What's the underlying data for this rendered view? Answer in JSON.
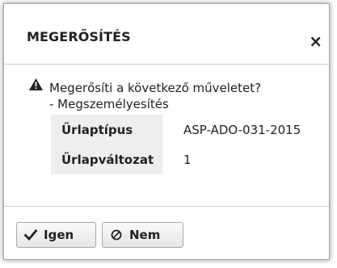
{
  "dialog": {
    "title": "MEGERŐSÍTÉS",
    "close_label": "×",
    "message": "Megerősíti a következő műveletet?",
    "action": "- Megszemélyesítés",
    "properties": [
      {
        "key": "Űrlaptípus",
        "value": "ASP-ADO-031-2015"
      },
      {
        "key": "Űrlapváltozat",
        "value": "1"
      }
    ],
    "buttons": {
      "yes_label": "Igen",
      "no_label": "Nem"
    }
  },
  "icons": {
    "warning": "warning-triangle-icon",
    "yes": "check-icon",
    "no": "circle-slash-icon",
    "close": "close-icon"
  },
  "colors": {
    "text": "#222222",
    "key_background": "#eeeeee",
    "border": "#a8a8a8"
  }
}
